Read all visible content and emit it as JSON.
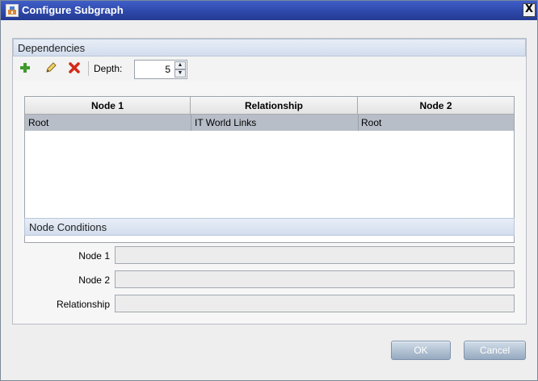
{
  "window": {
    "title": "Configure Subgraph",
    "close_label": "X"
  },
  "dependencies": {
    "header": "Dependencies",
    "toolbar": {
      "add_icon": "plus-icon",
      "edit_icon": "pencil-icon",
      "delete_icon": "red-x-icon",
      "depth_label": "Depth:",
      "depth_value": "5"
    },
    "table": {
      "columns": [
        "Node 1",
        "Relationship",
        "Node 2"
      ],
      "rows": [
        {
          "node1": "Root",
          "relationship": "IT World Links",
          "node2": "Root",
          "selected": true
        }
      ]
    }
  },
  "node_conditions": {
    "header": "Node Conditions",
    "fields": [
      {
        "label": "Node 1",
        "value": ""
      },
      {
        "label": "Node 2",
        "value": ""
      },
      {
        "label": "Relationship",
        "value": ""
      }
    ]
  },
  "buttons": {
    "ok": "OK",
    "cancel": "Cancel"
  },
  "colors": {
    "title_bar": "#2d47a8",
    "selected_row": "#b7bec8",
    "button": "#96a9bf"
  }
}
